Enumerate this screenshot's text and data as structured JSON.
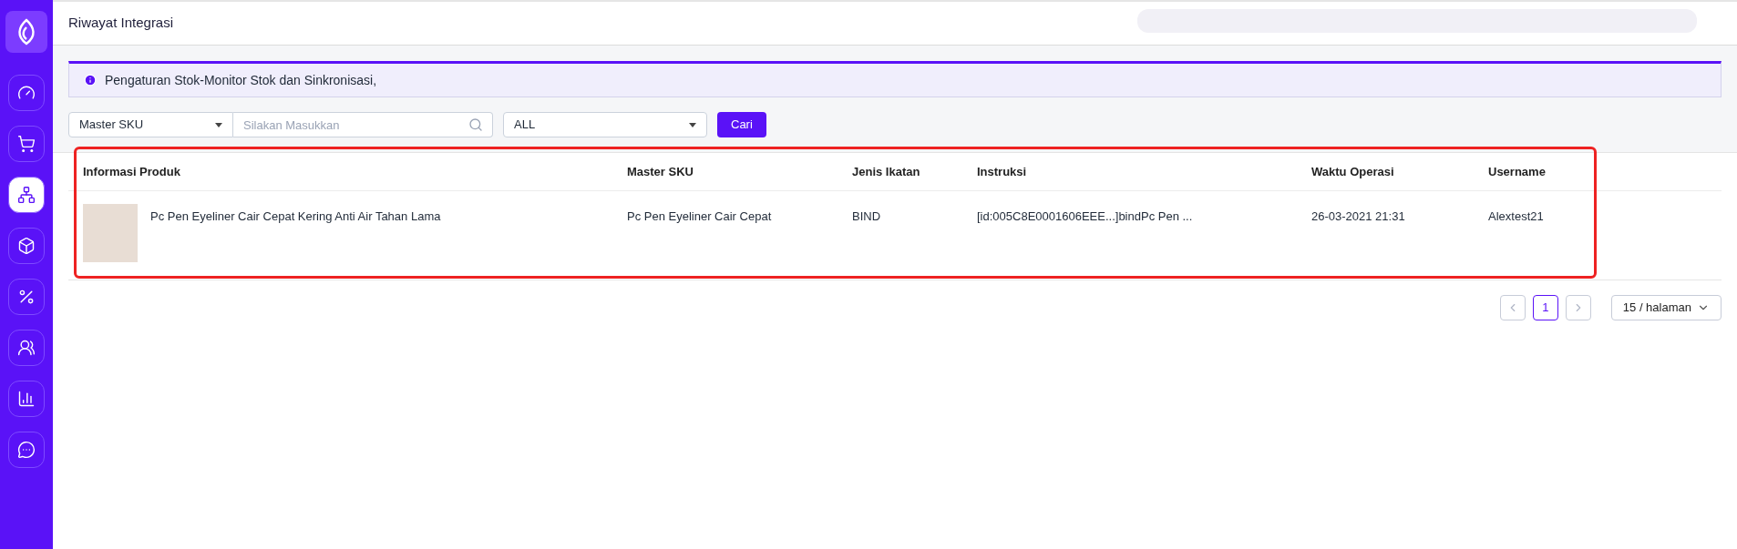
{
  "sidebar": {
    "items": [
      {
        "kind": "dashboard",
        "selected": false
      },
      {
        "kind": "cart",
        "selected": false
      },
      {
        "kind": "integration",
        "selected": true
      },
      {
        "kind": "box",
        "selected": false
      },
      {
        "kind": "promo",
        "selected": false
      },
      {
        "kind": "users",
        "selected": false
      },
      {
        "kind": "report",
        "selected": false
      },
      {
        "kind": "chat",
        "selected": false
      }
    ]
  },
  "header": {
    "title": "Riwayat Integrasi"
  },
  "alert": {
    "text": "Pengaturan Stok-Monitor Stok dan Sinkronisasi,"
  },
  "filters": {
    "field_select": "Master SKU",
    "search": {
      "placeholder": "Silakan Masukkan"
    },
    "type_select": "ALL",
    "button": "Cari"
  },
  "table": {
    "columns": [
      "Informasi Produk",
      "Master SKU",
      "Jenis Ikatan",
      "Instruksi",
      "Waktu Operasi",
      "Username"
    ],
    "rows": [
      {
        "product": "Pc Pen Eyeliner Cair Cepat Kering Anti Air Tahan Lama",
        "master_sku": "Pc Pen Eyeliner Cair Cepat",
        "bind_type": "BIND",
        "instruction": "[id:005C8E0001606EEE...]bindPc Pen ...",
        "time": "26-03-2021 21:31",
        "username": "Alextest21"
      }
    ]
  },
  "pagination": {
    "pages": [
      {
        "label": "1",
        "selected": true
      }
    ],
    "page_size": "15 / halaman"
  }
}
